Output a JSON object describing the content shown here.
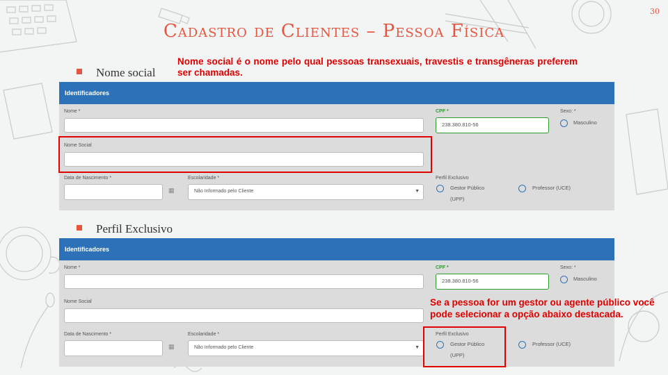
{
  "slide": {
    "number": "30",
    "title": "Cadastro de Clientes – Pessoa Física"
  },
  "section1": {
    "bullet": "Nome social",
    "note": "Nome social é o nome pelo qual pessoas transexuais, travestis e transgêneras preferem ser chamadas."
  },
  "section2": {
    "bullet": "Perfil Exclusivo",
    "note": "Se a pessoa for um gestor ou agente público você pode selecionar a opção abaixo destacada."
  },
  "form": {
    "header": "Identificadores",
    "nome_label": "Nome *",
    "nome_value": "",
    "cpf_label": "CPF *",
    "cpf_value": "238.380.810-56",
    "sexo_label": "Sexo: *",
    "sexo_option": "Masculino",
    "nome_social_label": "Nome Social",
    "nome_social_value": "",
    "nascimento_label": "Data de Nascimento *",
    "nascimento_value": "",
    "escolaridade_label": "Escolaridade *",
    "escolaridade_value": "Não Informado pelo Cliente",
    "perfil_label": "Perfil Exclusivo",
    "perfil_option1": "Gestor Público (UPP)",
    "perfil_option2": "Professor (UCE)",
    "calendar_icon": "calendar-icon",
    "dropdown_icon": "chevron-down-icon"
  },
  "colors": {
    "accent": "#e8553e",
    "header_blue": "#2d72b8",
    "highlight_red": "#e00000",
    "valid_green": "#2e9a2e"
  }
}
